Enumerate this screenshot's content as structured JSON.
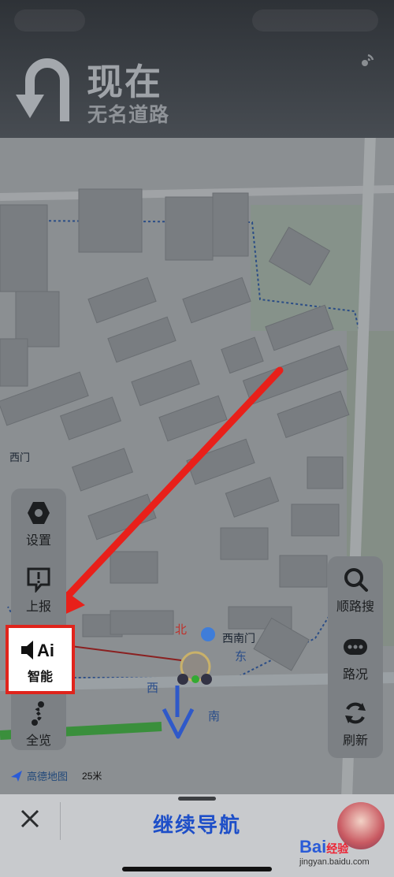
{
  "header": {
    "now": "现在",
    "road": "无名道路"
  },
  "map": {
    "labels": {
      "west_gate": "西门",
      "southwest_gate": "西南门",
      "north": "北",
      "east": "东",
      "west": "西",
      "south": "南"
    },
    "attribution": "高德地图",
    "scale": "25米"
  },
  "left_panel": {
    "settings": "设置",
    "report": "上报",
    "ai": "智能",
    "ai_glyph": "Ai",
    "overview": "全览"
  },
  "right_panel": {
    "search_along": "顺路搜",
    "traffic": "路况",
    "refresh": "刷新"
  },
  "bottom": {
    "continue": "继续导航"
  },
  "watermark": {
    "brand": "Bai",
    "brand2": "经验",
    "url": "jingyan.baidu.com"
  },
  "colors": {
    "accent": "#1e4fc8",
    "highlight": "#e0241c",
    "route": "#2f59c9",
    "arrow": "#e8201a"
  }
}
